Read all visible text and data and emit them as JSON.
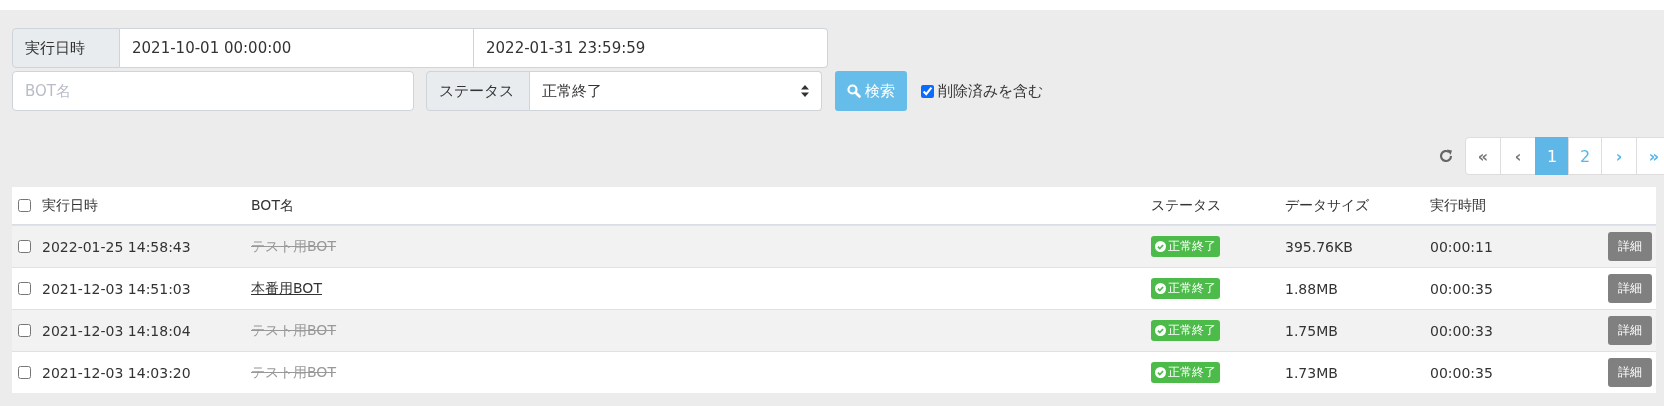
{
  "filters": {
    "date_label": "実行日時",
    "date_from": "2021-10-01 00:00:00",
    "date_to": "2022-01-31 23:59:59",
    "bot_placeholder": "BOT名",
    "status_label": "ステータス",
    "status_value": "正常終了",
    "search_button": "検索",
    "include_deleted": {
      "label": "削除済みを含む",
      "checked": true
    }
  },
  "pagination": [
    {
      "label": "«",
      "kind": "first",
      "selected": false
    },
    {
      "label": "‹",
      "kind": "prev",
      "selected": false
    },
    {
      "label": "1",
      "kind": "page",
      "selected": true
    },
    {
      "label": "2",
      "kind": "page",
      "selected": false
    },
    {
      "label": "›",
      "kind": "next",
      "selected": false
    },
    {
      "label": "»",
      "kind": "last",
      "selected": false
    }
  ],
  "table": {
    "select_all_checked": false,
    "columns": [
      "実行日時",
      "BOT名",
      "ステータス",
      "データサイズ",
      "実行時間"
    ],
    "rows": [
      {
        "checked": false,
        "date": "2022-01-25 14:58:43",
        "bot": "テスト用BOT",
        "deleted": true,
        "status": "正常終了",
        "success": true,
        "size": "395.76KB",
        "duration": "00:00:11",
        "action": "詳細"
      },
      {
        "checked": false,
        "date": "2021-12-03 14:51:03",
        "bot": "本番用BOT",
        "deleted": false,
        "status": "正常終了",
        "success": true,
        "size": "1.88MB",
        "duration": "00:00:35",
        "action": "詳細"
      },
      {
        "checked": false,
        "date": "2021-12-03 14:18:04",
        "bot": "テスト用BOT",
        "deleted": true,
        "status": "正常終了",
        "success": true,
        "size": "1.75MB",
        "duration": "00:00:33",
        "action": "詳細"
      },
      {
        "checked": false,
        "date": "2021-12-03 14:03:20",
        "bot": "テスト用BOT",
        "deleted": true,
        "status": "正常終了",
        "success": true,
        "size": "1.73MB",
        "duration": "00:00:35",
        "action": "詳細"
      }
    ]
  }
}
